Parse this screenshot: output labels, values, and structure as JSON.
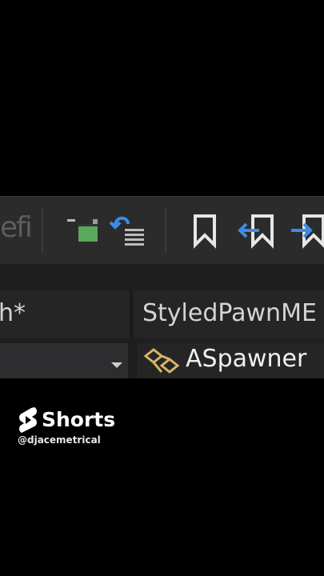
{
  "toolbar": {
    "faded_text": "efi",
    "buttons": [
      {
        "icon": "comment-lines-icon"
      },
      {
        "icon": "uncomment-lines-icon"
      },
      {
        "icon": "bookmark-icon"
      },
      {
        "icon": "previous-bookmark-icon"
      },
      {
        "icon": "next-bookmark-icon"
      }
    ]
  },
  "tabs": {
    "left": "h*",
    "right": "StyledPawnME"
  },
  "navbar": {
    "class_name": "ASpawner",
    "class_icon": "class-icon"
  },
  "overlay": {
    "brand": "Shorts",
    "handle": "@djacemetrical"
  },
  "colors": {
    "accent_blue": "#3c8ce6",
    "class_icon": "#d7b469",
    "comment_green": "#5aa85a"
  }
}
